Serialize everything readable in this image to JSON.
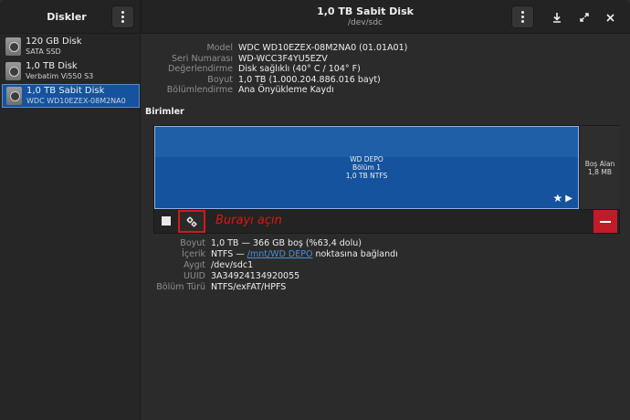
{
  "header": {
    "sidebar_title": "Diskler",
    "title": "1,0 TB Sabit Disk",
    "subtitle": "/dev/sdc",
    "icons": {
      "menu": "vertical-dots-icon",
      "eject": "download-icon",
      "expand": "expand-icon",
      "close": "close-icon"
    }
  },
  "sidebar": {
    "items": [
      {
        "name": "120 GB Disk",
        "sub": "SATA SSD",
        "selected": false
      },
      {
        "name": "1,0 TB Disk",
        "sub": "Verbatim Vi550 S3",
        "selected": false
      },
      {
        "name": "1,0 TB Sabit Disk",
        "sub": "WDC WD10EZEX-08M2NA0",
        "selected": true
      }
    ]
  },
  "disk_info": {
    "model_label": "Model",
    "model_value": "WDC WD10EZEX-08M2NA0 (01.01A01)",
    "serial_label": "Seri Numarası",
    "serial_value": "WD-WCC3F4YU5EZV",
    "assessment_label": "Değerlendirme",
    "assessment_value": "Disk sağlıklı (40° C / 104° F)",
    "size_label": "Boyut",
    "size_value": "1,0 TB (1.000.204.886.016 bayt)",
    "partitioning_label": "Bölümlendirme",
    "partitioning_value": "Ana Önyükleme Kaydı"
  },
  "volumes": {
    "title": "Birimler",
    "partition": {
      "name": "WD DEPO",
      "number": "Bölüm 1",
      "size_fs": "1,0 TB NTFS"
    },
    "free": {
      "label": "Boş Alan",
      "size": "1,8 MB"
    },
    "hint": "Burayı açın"
  },
  "volume_info": {
    "size_label": "Boyut",
    "size_value": "1,0 TB — 366 GB boş (%63,4 dolu)",
    "contents_label": "İçerik",
    "contents_prefix": "NTFS — ",
    "contents_link": "/mnt/WD DEPO",
    "contents_suffix": " noktasına bağlandı",
    "device_label": "Aygıt",
    "device_value": "/dev/sdc1",
    "uuid_label": "UUID",
    "uuid_value": "3A34924134920055",
    "type_label": "Bölüm Türü",
    "type_value": "NTFS/exFAT/HPFS"
  },
  "colors": {
    "accent": "#15539e",
    "destructive": "#c01c28",
    "highlight": "#e01414"
  }
}
